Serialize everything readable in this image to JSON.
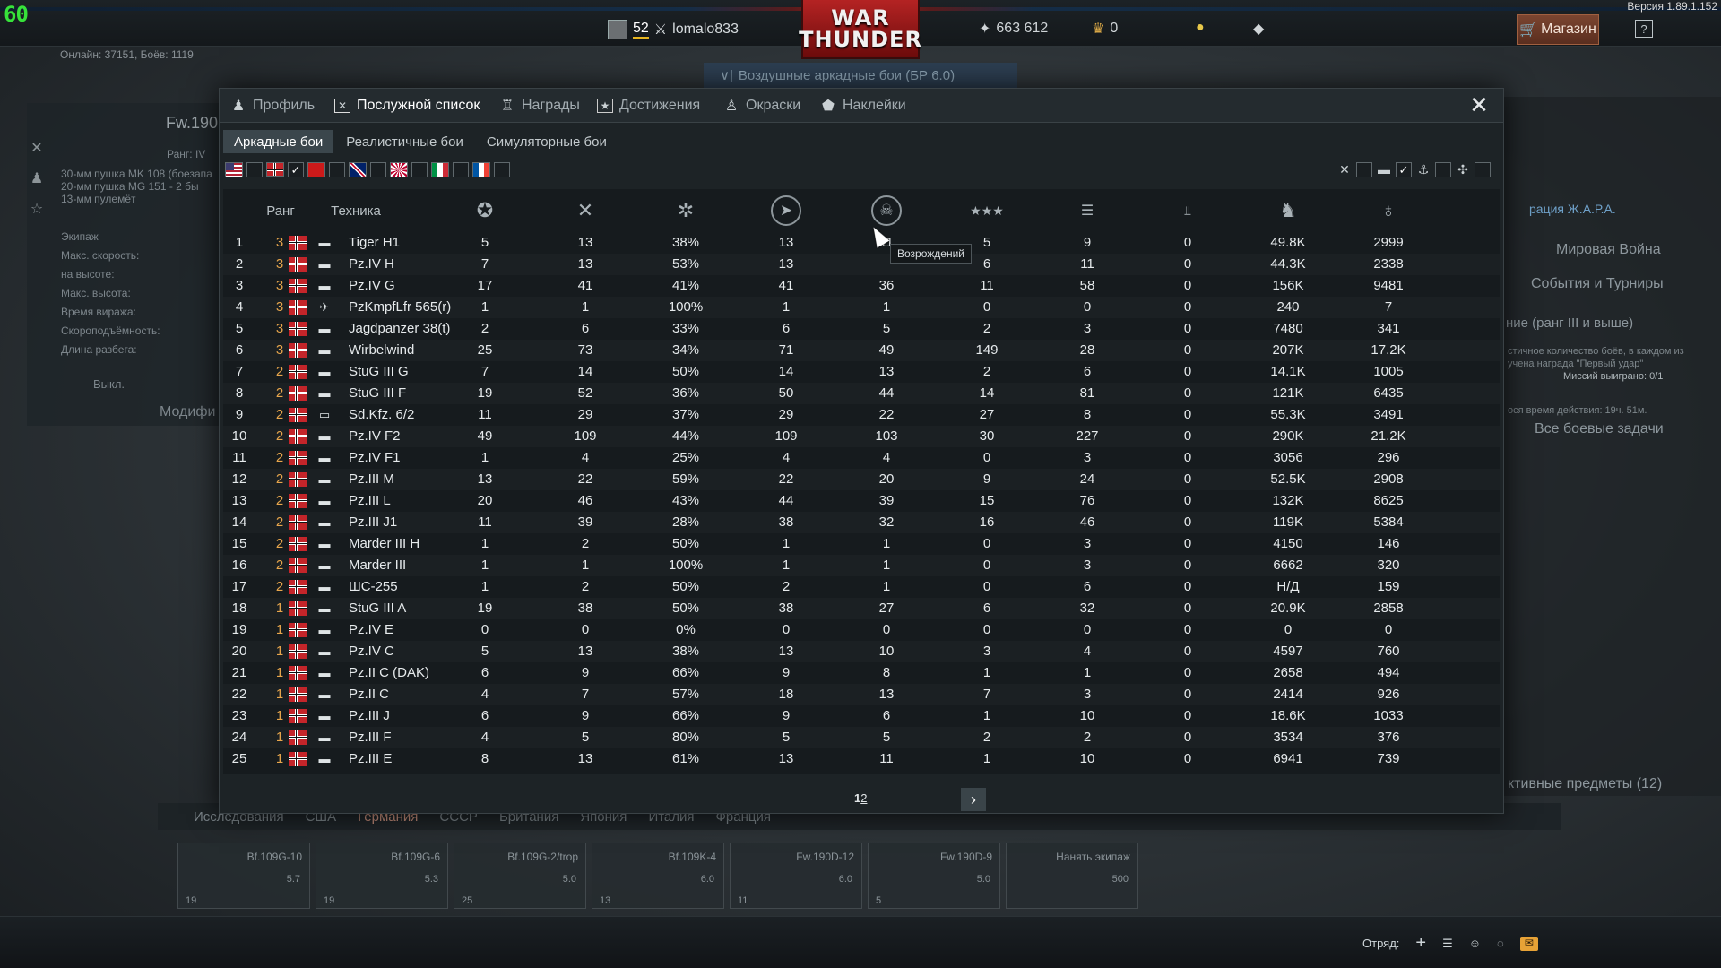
{
  "hud": {
    "fps": "60",
    "version": "Версия 1.89.1.152",
    "online": "Онлайн: 37151, Боёв: 1119",
    "player_level": "52",
    "player_name": "lomalo833",
    "logo_line1": "WAR",
    "logo_line2": "THUNDER",
    "silver_lions": "663 612",
    "golden_eagles": "0",
    "shop_label": "Магазин",
    "help_label": "?",
    "game_mode": "Воздушные аркадные бои (БР 6.0)"
  },
  "background": {
    "aircraft_title": "Fw.190",
    "aircraft_rank": "Ранг: IV",
    "weapons": [
      "30-мм пушка MK 108 (боезапа",
      "20-мм пушка MG 151 - 2 бы",
      "13-мм пулемёт"
    ],
    "stats": [
      "Экипаж",
      "Макс. скорость:",
      "на высоте:",
      "Макс. высота:",
      "Время виража:",
      "Скороподъёмность:",
      "Длина разбега:"
    ],
    "off_button": "Выкл.",
    "modification_label": "Модифи",
    "right_links": [
      "Мировая Война",
      "События и Турниры",
      "ние (ранг III и выше)",
      "Все боевые задачи"
    ],
    "right_notes": [
      "стичное количество боёв, в каждом из",
      "учена награда \"Первый удар\"",
      "Миссий выиграно: 0/1",
      "ося время действия: 19ч. 51м."
    ],
    "operation_label": "рация Ж.А.Р.А.",
    "active_items": "ктивные предметы (12)",
    "research_tab": "Исследования",
    "nations": [
      "США",
      "Германия",
      "СССР",
      "Британия",
      "Япония",
      "Италия",
      "Франция"
    ],
    "crew_slots": [
      {
        "name": "Bf.109G-10",
        "br": "5.7",
        "count": "19"
      },
      {
        "name": "Bf.109G-6",
        "br": "5.3",
        "count": "19"
      },
      {
        "name": "Bf.109G-2/trop",
        "br": "5.0",
        "count": "25"
      },
      {
        "name": "Bf.109K-4",
        "br": "6.0",
        "count": "13"
      },
      {
        "name": "Fw.190D-12",
        "br": "6.0",
        "count": "11"
      },
      {
        "name": "Fw.190D-9",
        "br": "5.0",
        "count": "5"
      },
      {
        "name": "Нанять экипаж",
        "br": "500",
        "count": ""
      }
    ],
    "squad_label": "Отряд:"
  },
  "modal": {
    "tabs": [
      {
        "label": "Профиль",
        "icon": "profile-icon"
      },
      {
        "label": "Послужной список",
        "icon": "service-record-icon",
        "active": true
      },
      {
        "label": "Награды",
        "icon": "medal-icon"
      },
      {
        "label": "Достижения",
        "icon": "achievement-icon"
      },
      {
        "label": "Окраски",
        "icon": "paint-icon"
      },
      {
        "label": "Наклейки",
        "icon": "decal-icon"
      }
    ],
    "subtabs": [
      "Аркадные бои",
      "Реалистичные бои",
      "Симуляторные бои"
    ],
    "active_subtab": "Аркадные бои",
    "tooltip": "Возрождений",
    "pages": "1",
    "pages_current": "2",
    "columns": {
      "rank": "Ранг",
      "vehicle": "Техника",
      "icons": [
        "victories-icon",
        "missions-icon",
        "win-rate-icon",
        "respawns-icon",
        "deaths-icon",
        "ground-kills-icon",
        "air-kills-icon",
        "naval-kills-icon",
        "lions-icon",
        "activity-icon"
      ]
    },
    "rows": [
      {
        "n": "1",
        "rank": "3",
        "type": "tank",
        "name": "Tiger H1",
        "c": [
          "5",
          "13",
          "38%",
          "13",
          "11",
          "5",
          "9",
          "0",
          "49.8K",
          "2999"
        ]
      },
      {
        "n": "2",
        "rank": "3",
        "type": "tank",
        "name": "Pz.IV H",
        "c": [
          "7",
          "13",
          "53%",
          "13",
          "",
          "6",
          "11",
          "0",
          "44.3K",
          "2338"
        ]
      },
      {
        "n": "3",
        "rank": "3",
        "type": "tank",
        "name": "Pz.IV G",
        "c": [
          "17",
          "41",
          "41%",
          "41",
          "36",
          "11",
          "58",
          "0",
          "156K",
          "9481"
        ]
      },
      {
        "n": "4",
        "rank": "3",
        "type": "heli",
        "name": "PzKmpfLfr 565(r)",
        "c": [
          "1",
          "1",
          "100%",
          "1",
          "1",
          "0",
          "0",
          "0",
          "240",
          "7"
        ]
      },
      {
        "n": "5",
        "rank": "3",
        "type": "tank",
        "name": "Jagdpanzer 38(t)",
        "c": [
          "2",
          "6",
          "33%",
          "6",
          "5",
          "2",
          "3",
          "0",
          "7480",
          "341"
        ]
      },
      {
        "n": "6",
        "rank": "3",
        "type": "tank",
        "name": "Wirbelwind",
        "c": [
          "25",
          "73",
          "34%",
          "71",
          "49",
          "149",
          "28",
          "0",
          "207K",
          "17.2K"
        ]
      },
      {
        "n": "7",
        "rank": "2",
        "type": "tank",
        "name": "StuG III G",
        "c": [
          "7",
          "14",
          "50%",
          "14",
          "13",
          "2",
          "6",
          "0",
          "14.1K",
          "1005"
        ]
      },
      {
        "n": "8",
        "rank": "2",
        "type": "tank",
        "name": "StuG III F",
        "c": [
          "19",
          "52",
          "36%",
          "50",
          "44",
          "14",
          "81",
          "0",
          "121K",
          "6435"
        ]
      },
      {
        "n": "9",
        "rank": "2",
        "type": "spaa",
        "name": "Sd.Kfz. 6/2",
        "c": [
          "11",
          "29",
          "37%",
          "29",
          "22",
          "27",
          "8",
          "0",
          "55.3K",
          "3491"
        ]
      },
      {
        "n": "10",
        "rank": "2",
        "type": "tank",
        "name": "Pz.IV F2",
        "c": [
          "49",
          "109",
          "44%",
          "109",
          "103",
          "30",
          "227",
          "0",
          "290K",
          "21.2K"
        ]
      },
      {
        "n": "11",
        "rank": "2",
        "type": "tank",
        "name": "Pz.IV F1",
        "c": [
          "1",
          "4",
          "25%",
          "4",
          "4",
          "0",
          "3",
          "0",
          "3056",
          "296"
        ]
      },
      {
        "n": "12",
        "rank": "2",
        "type": "tank",
        "name": "Pz.III M",
        "c": [
          "13",
          "22",
          "59%",
          "22",
          "20",
          "9",
          "24",
          "0",
          "52.5K",
          "2908"
        ]
      },
      {
        "n": "13",
        "rank": "2",
        "type": "tank",
        "name": "Pz.III L",
        "c": [
          "20",
          "46",
          "43%",
          "44",
          "39",
          "15",
          "76",
          "0",
          "132K",
          "8625"
        ]
      },
      {
        "n": "14",
        "rank": "2",
        "type": "tank",
        "name": "Pz.III J1",
        "c": [
          "11",
          "39",
          "28%",
          "38",
          "32",
          "16",
          "46",
          "0",
          "119K",
          "5384"
        ]
      },
      {
        "n": "15",
        "rank": "2",
        "type": "tank",
        "name": "Marder III H",
        "c": [
          "1",
          "2",
          "50%",
          "1",
          "1",
          "0",
          "3",
          "0",
          "4150",
          "146"
        ]
      },
      {
        "n": "16",
        "rank": "2",
        "type": "tank",
        "name": "Marder III",
        "c": [
          "1",
          "1",
          "100%",
          "1",
          "1",
          "0",
          "3",
          "0",
          "6662",
          "320"
        ]
      },
      {
        "n": "17",
        "rank": "2",
        "type": "tank",
        "name": "ШС-255",
        "c": [
          "1",
          "2",
          "50%",
          "2",
          "1",
          "0",
          "6",
          "0",
          "Н/Д",
          "159"
        ]
      },
      {
        "n": "18",
        "rank": "1",
        "type": "tank",
        "name": "StuG III A",
        "c": [
          "19",
          "38",
          "50%",
          "38",
          "27",
          "6",
          "32",
          "0",
          "20.9K",
          "2858"
        ]
      },
      {
        "n": "19",
        "rank": "1",
        "type": "tank",
        "name": "Pz.IV E",
        "c": [
          "0",
          "0",
          "0%",
          "0",
          "0",
          "0",
          "0",
          "0",
          "0",
          "0"
        ]
      },
      {
        "n": "20",
        "rank": "1",
        "type": "tank",
        "name": "Pz.IV C",
        "c": [
          "5",
          "13",
          "38%",
          "13",
          "10",
          "3",
          "4",
          "0",
          "4597",
          "760"
        ]
      },
      {
        "n": "21",
        "rank": "1",
        "type": "tank",
        "name": "Pz.II C (DAK)",
        "c": [
          "6",
          "9",
          "66%",
          "9",
          "8",
          "1",
          "1",
          "0",
          "2658",
          "494"
        ]
      },
      {
        "n": "22",
        "rank": "1",
        "type": "tank",
        "name": "Pz.II C",
        "c": [
          "4",
          "7",
          "57%",
          "18",
          "13",
          "7",
          "3",
          "0",
          "2414",
          "926"
        ]
      },
      {
        "n": "23",
        "rank": "1",
        "type": "tank",
        "name": "Pz.III J",
        "c": [
          "6",
          "9",
          "66%",
          "9",
          "6",
          "1",
          "10",
          "0",
          "18.6K",
          "1033"
        ]
      },
      {
        "n": "24",
        "rank": "1",
        "type": "tank",
        "name": "Pz.III F",
        "c": [
          "4",
          "5",
          "80%",
          "5",
          "5",
          "2",
          "2",
          "0",
          "3534",
          "376"
        ]
      },
      {
        "n": "25",
        "rank": "1",
        "type": "tank",
        "name": "Pz.III E",
        "c": [
          "8",
          "13",
          "61%",
          "13",
          "11",
          "1",
          "10",
          "0",
          "6941",
          "739"
        ]
      }
    ]
  }
}
